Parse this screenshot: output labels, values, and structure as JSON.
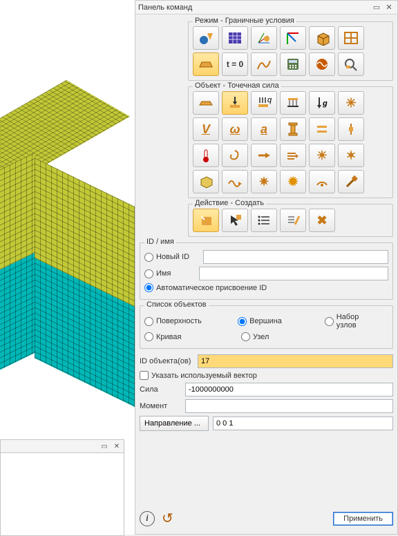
{
  "panel": {
    "title": "Панель команд"
  },
  "groups": {
    "mode": "Режим - Граничные условия",
    "object": "Объект - Точечная сила",
    "action": "Действие - Создать"
  },
  "idname": {
    "legend": "ID / имя",
    "new_id": "Новый ID",
    "name": "Имя",
    "auto": "Автоматическое присвоение ID"
  },
  "objlist": {
    "legend": "Список объектов",
    "surface": "Поверхность",
    "vertex": "Вершина",
    "nodeset": "Набор узлов",
    "curve": "Кривая",
    "node": "Узел"
  },
  "fields": {
    "id_label": "ID объекта(ов)",
    "id_value": "17",
    "vector_cb": "Указать используемый вектор",
    "force_label": "Сила",
    "force_value": "-1000000000",
    "moment_label": "Момент",
    "moment_value": "",
    "direction_btn": "Направление ...",
    "direction_value": "0 0 1"
  },
  "footer": {
    "apply": "Применить"
  },
  "icons": {
    "mode": [
      "geometry",
      "mesh",
      "bc-axes",
      "materials",
      "cube",
      "grid",
      "plane",
      "t0",
      "curve",
      "calc",
      "wave",
      "lens"
    ],
    "object": [
      "beam",
      "point-force",
      "distributed-q",
      "support",
      "gravity",
      "special",
      "velocity-v",
      "omega",
      "acceleration-a",
      "column",
      "gap",
      "axis",
      "thermal",
      "spiral",
      "arrow-right",
      "wind",
      "sun",
      "star",
      "block",
      "wave-arrow",
      "star2",
      "sun2",
      "radar",
      "hammer"
    ],
    "action": [
      "create",
      "pick",
      "list",
      "edit",
      "delete"
    ]
  }
}
